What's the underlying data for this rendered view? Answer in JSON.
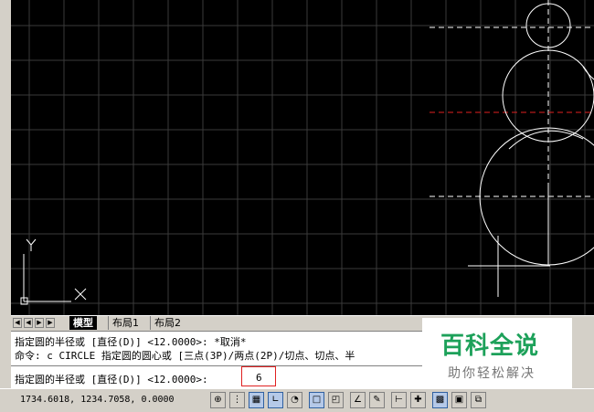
{
  "tabs": {
    "model": "模型",
    "layout1": "布局1",
    "layout2": "布局2"
  },
  "nav": {
    "first": "◀",
    "prev": "◀",
    "next": "▶",
    "last": "▶"
  },
  "command": {
    "history1": "指定圆的半径或 [直径(D)] <12.0000>: *取消*",
    "history2": "命令: c CIRCLE 指定圆的圆心或 [三点(3P)/两点(2P)/切点、切点、半",
    "prompt": "指定圆的半径或 [直径(D)] <12.0000>: ",
    "input": "6"
  },
  "watermark": {
    "title": "百科全说",
    "subtitle": "助你轻松解决"
  },
  "ucs": {
    "x_label": "X",
    "y_label": "Y"
  },
  "status": {
    "coordinates": "1734.6018, 1234.7058, 0.0000"
  },
  "colors": {
    "canvas_bg": "#000000",
    "grid": "#3a3a3a",
    "geometry": "#ffffff",
    "center_line_red": "#e02020",
    "highlight_box": "#e02020",
    "brand_green": "#1da15a"
  }
}
